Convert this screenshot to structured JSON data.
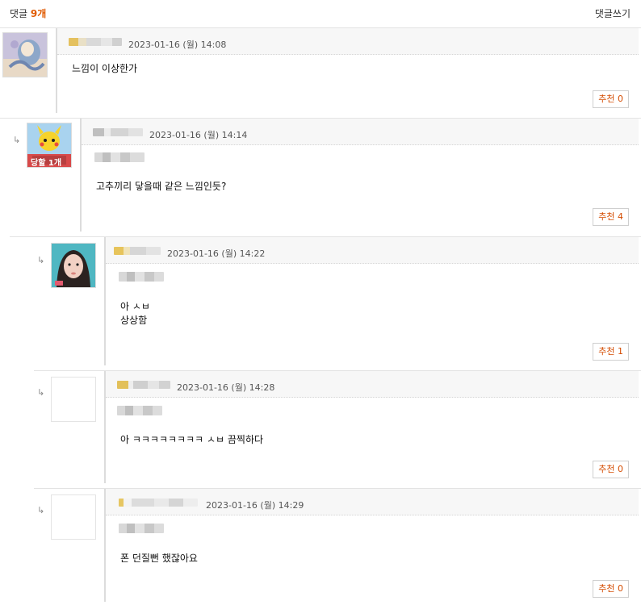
{
  "header": {
    "title_label": "댓글",
    "count": "9개",
    "write_label": "댓글쓰기"
  },
  "colors": {
    "accent": "#e05a00",
    "recommend": "#d44b00",
    "meta_bg": "#f7f7f7"
  },
  "reply_marker": "↳",
  "recommend_label": "추천",
  "comments": [
    {
      "datetime": "2023-01-16 (월) 14:08",
      "text": "느낌이 이상한가",
      "recommend": "0",
      "avatar": "cartoon-avatar-icon"
    },
    {
      "datetime": "2023-01-16 (월) 14:14",
      "avatar_text": "당할 1개",
      "text": "고추끼리 닿을때 같은 느낌인듯?",
      "recommend": "4",
      "avatar": "pikachu-avatar-icon"
    },
    {
      "datetime": "2023-01-16 (월) 14:22",
      "text": "아 ㅅㅂ\n상상함",
      "recommend": "1",
      "avatar": "photo-avatar-icon"
    },
    {
      "datetime": "2023-01-16 (월) 14:28",
      "text": "아 ㅋㅋㅋㅋㅋㅋㅋㅋ ㅅㅂ 끔찍하다",
      "recommend": "0",
      "avatar": "empty-avatar"
    },
    {
      "datetime": "2023-01-16 (월) 14:29",
      "text": "폰 던질뻔 했잖아요",
      "recommend": "0",
      "avatar": "empty-avatar"
    }
  ]
}
